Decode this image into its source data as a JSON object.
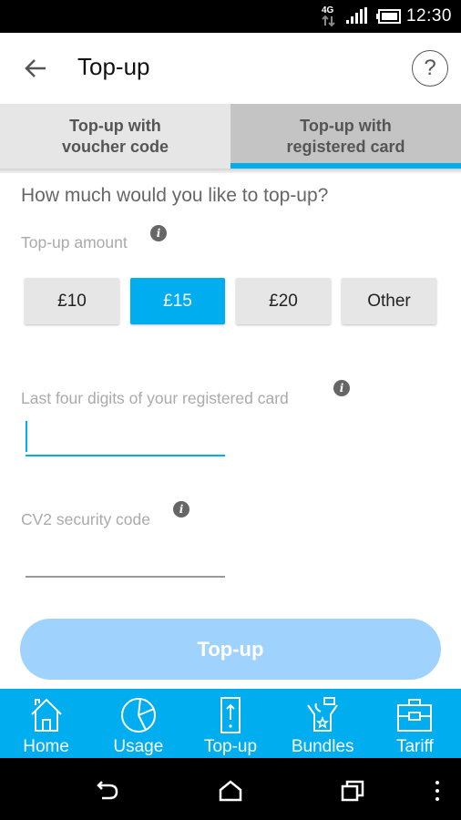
{
  "status_bar": {
    "time": "12:30",
    "network_label": "4G",
    "icons": [
      "network-4g-icon",
      "signal-icon",
      "battery-icon"
    ]
  },
  "app_bar": {
    "title": "Top-up",
    "back_icon": "arrow-left-icon",
    "help_icon": "question-circle-icon",
    "help_glyph": "?"
  },
  "tabs": [
    {
      "line1": "Top-up with",
      "line2": "voucher code",
      "active": false
    },
    {
      "line1": "Top-up with",
      "line2": "registered card",
      "active": true
    }
  ],
  "form": {
    "question": "How much would you like to top-up?",
    "amount_label": "Top-up amount",
    "amounts": [
      {
        "label": "£10",
        "selected": false
      },
      {
        "label": "£15",
        "selected": true
      },
      {
        "label": "£20",
        "selected": false
      },
      {
        "label": "Other",
        "selected": false
      }
    ],
    "card_digits_label": "Last four digits of your registered card",
    "card_digits_value": "",
    "cv2_label": "CV2 security code",
    "cv2_value": "",
    "info_glyph": "i",
    "submit_label": "Top-up"
  },
  "bottom_nav": [
    {
      "label": "Home",
      "icon": "home-icon"
    },
    {
      "label": "Usage",
      "icon": "pie-chart-icon"
    },
    {
      "label": "Top-up",
      "icon": "phone-topup-icon"
    },
    {
      "label": "Bundles",
      "icon": "bundles-icon"
    },
    {
      "label": "Tariff",
      "icon": "briefcase-icon"
    }
  ],
  "system_nav": [
    "back-icon",
    "home-icon",
    "recent-apps-icon",
    "overflow-menu-icon"
  ],
  "colors": {
    "accent": "#00adef",
    "button_disabled": "#9fd3fd",
    "tab_inactive": "#e6e6e6",
    "tab_active": "#c4c4c4"
  }
}
